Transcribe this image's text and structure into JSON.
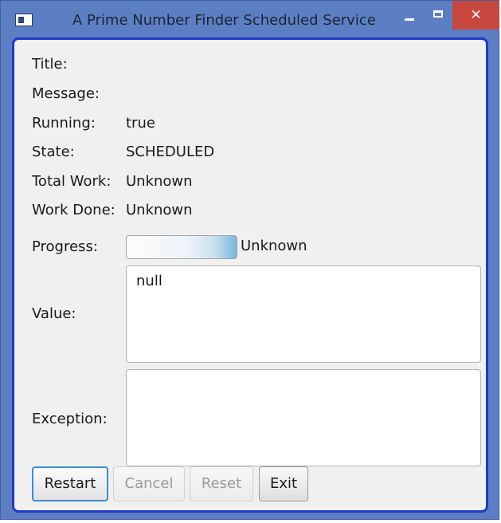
{
  "window": {
    "title": "A Prime Number Finder Scheduled Service",
    "close_glyph": "✕"
  },
  "fields": [
    {
      "label": "Title:",
      "value": ""
    },
    {
      "label": "Message:",
      "value": ""
    },
    {
      "label": "Running:",
      "value": "true"
    },
    {
      "label": "State:",
      "value": "SCHEDULED"
    },
    {
      "label": "Total Work:",
      "value": "Unknown"
    },
    {
      "label": "Work Done:",
      "value": "Unknown"
    }
  ],
  "progress": {
    "label": "Progress:",
    "text": "Unknown",
    "indeterminate": true
  },
  "value_field": {
    "label": "Value:",
    "content": "null"
  },
  "exception_field": {
    "label": "Exception:",
    "content": ""
  },
  "buttons": {
    "restart": "Restart",
    "cancel": "Cancel",
    "reset": "Reset",
    "exit": "Exit"
  },
  "colors": {
    "title_bar": "#5b7fc2",
    "close_button": "#c7463e",
    "focus_border": "#1f39c8",
    "content_background": "#f0f0f0"
  }
}
